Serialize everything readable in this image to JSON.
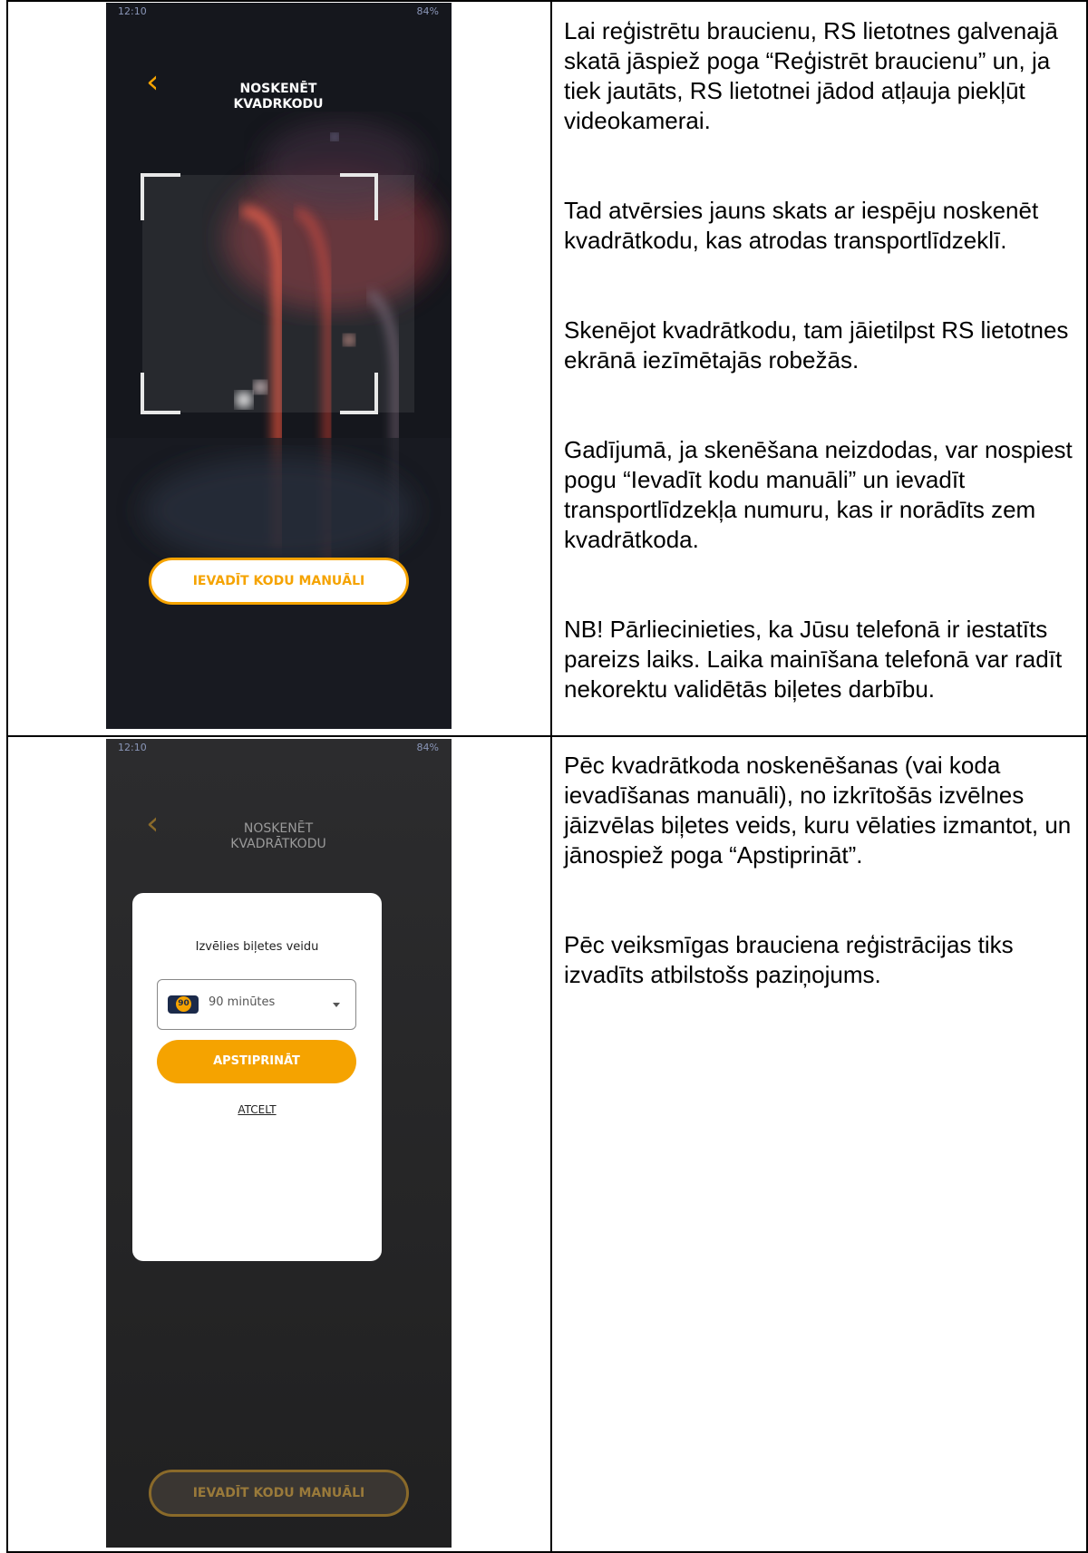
{
  "scan_screen": {
    "status_time": "12:10",
    "status_right": "84%",
    "header_title": "NOSKENĒT KVADRKODU",
    "back_icon": "chevron-left-icon",
    "manual_button": "IEVADĪT KODU MANUĀLI"
  },
  "ticket_screen": {
    "status_time": "12:10",
    "status_right": "84%",
    "header_title": "NOSKENĒT KVADRĀTKODU",
    "dialog": {
      "title": "Izvēlies biļetes veidu",
      "select_badge": "90",
      "select_value": "90 minūtes",
      "confirm_button": "APSTIPRINĀT",
      "cancel_link": "ATCELT"
    },
    "manual_button": "IEVADĪT KODU MANUĀLI"
  },
  "instructions_1": [
    "Lai reģistrētu braucienu, RS lietotnes galvenajā skatā jāspiež poga “Reģistrēt braucienu” un, ja tiek jautāts, RS lietotnei jādod atļauja piekļūt videokamerai.",
    "Tad atvērsies jauns skats ar iespēju noskenēt kvadrātkodu, kas atrodas transportlīdzeklī.",
    "Skenējot kvadrātkodu, tam jāietilpst RS lietotnes ekrānā iezīmētajās robežās.",
    "Gadījumā, ja skenēšana neizdodas, var nospiest pogu “Ievadīt kodu manuāli” un ievadīt transportlīdzekļa numuru, kas ir norādīts zem kvadrātkoda.",
    "NB! Pārliecinieties, ka Jūsu telefonā ir iestatīts pareizs laiks. Laika mainīšana telefonā var radīt nekorektu validētās biļetes darbību."
  ],
  "instructions_2": [
    "Pēc kvadrātkoda noskenēšanas (vai koda ievadīšanas manuāli), no izkrītošās izvēlnes jāizvēlas biļetes veids, kuru vēlaties izmantot, un jānospiež poga “Apstiprināt”.",
    "Pēc veiksmīgas brauciena reģistrācijas tiks izvadīts atbilstošs paziņojums."
  ]
}
